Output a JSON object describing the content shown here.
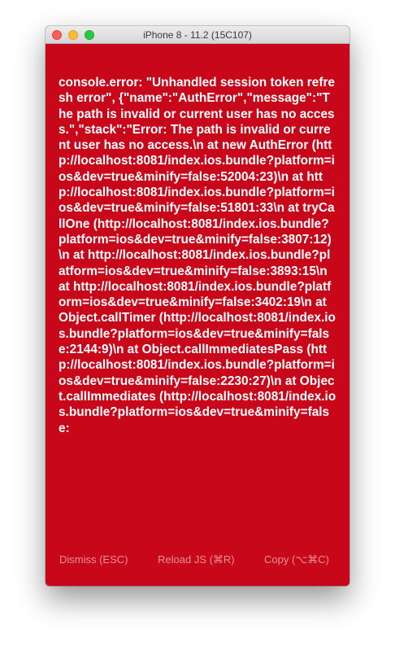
{
  "window": {
    "title": "iPhone 8 - 11.2 (15C107)"
  },
  "redbox": {
    "message": "console.error: \"Unhandled session token refresh error\", {\"name\":\"AuthError\",\"message\":\"The path is invalid or current user has no access.\",\"stack\":\"Error: The path is invalid or current user has no access.\\n    at new AuthError (http://localhost:8081/index.ios.bundle?platform=ios&dev=true&minify=false:52004:23)\\n    at http://localhost:8081/index.ios.bundle?platform=ios&dev=true&minify=false:51801:33\\n    at tryCallOne (http://localhost:8081/index.ios.bundle?platform=ios&dev=true&minify=false:3807:12)\\n    at http://localhost:8081/index.ios.bundle?platform=ios&dev=true&minify=false:3893:15\\n    at http://localhost:8081/index.ios.bundle?platform=ios&dev=true&minify=false:3402:19\\n    at Object.callTimer (http://localhost:8081/index.ios.bundle?platform=ios&dev=true&minify=false:2144:9)\\n    at Object.callImmediatesPass (http://localhost:8081/index.ios.bundle?platform=ios&dev=true&minify=false:2230:27)\\n    at Object.callImmediates (http://localhost:8081/index.ios.bundle?platform=ios&dev=true&minify=false:",
    "buttons": {
      "dismiss": "Dismiss (ESC)",
      "reload": "Reload JS (⌘R)",
      "copy": "Copy (⌥⌘C)"
    }
  },
  "colors": {
    "background": "#c8071a",
    "text": "#ffffff"
  }
}
